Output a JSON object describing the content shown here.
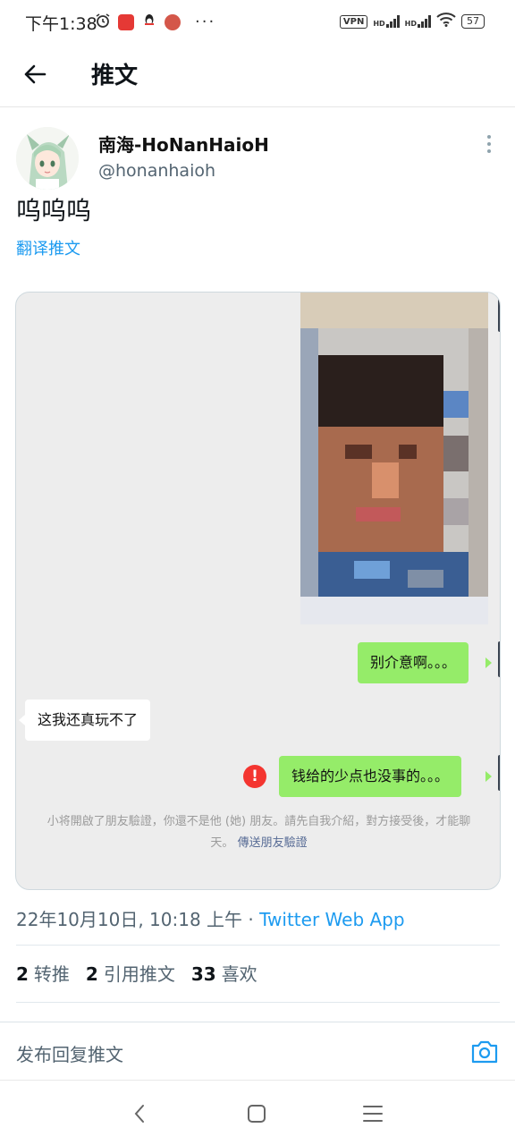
{
  "status_bar": {
    "time": "下午1:38",
    "vpn": "VPN",
    "hd1": "HD",
    "hd2": "HD",
    "battery": "57",
    "more": "···"
  },
  "header": {
    "title": "推文"
  },
  "tweet": {
    "author_name": "南海-HoNanHaioH",
    "author_handle": "@honanhaioh",
    "text": "呜呜呜",
    "translate_label": "翻译推文"
  },
  "media": {
    "messages": [
      {
        "side": "right",
        "text": "别介意啊。。。"
      },
      {
        "side": "left",
        "text": "这我还真玩不了"
      },
      {
        "side": "right",
        "text": "钱给的少点也没事的。。。",
        "failed": true
      }
    ],
    "alert_glyph": "!",
    "notice_line1": "小将開啟了朋友驗證，你還不是他 (她) 朋友。請先自我介紹，對方接受後，才能聊",
    "notice_line2": "天。",
    "notice_link": "傳送朋友驗證"
  },
  "meta": {
    "timestamp": "22年10月10日, 10:18 上午",
    "separator": "·",
    "source": "Twitter Web App"
  },
  "stats": {
    "retweets_count": "2",
    "retweets_label": "转推",
    "quotes_count": "2",
    "quotes_label": "引用推文",
    "likes_count": "33",
    "likes_label": "喜欢"
  },
  "reply": {
    "placeholder": "发布回复推文"
  },
  "colors": {
    "link": "#1d9bf0",
    "wechat_green": "#95ec69",
    "alert_red": "#f43530"
  }
}
